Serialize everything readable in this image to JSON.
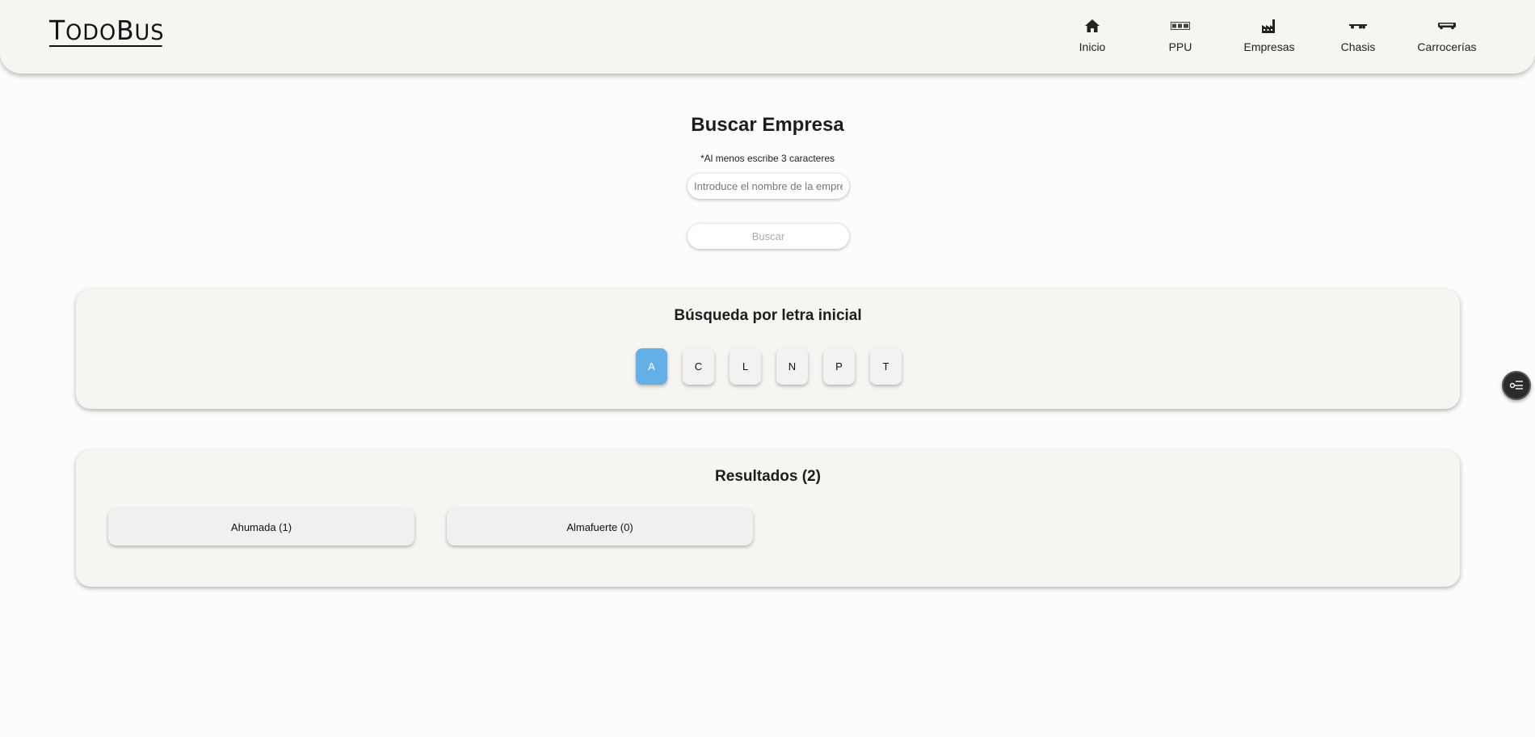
{
  "header": {
    "logo_text": "TODOBUS",
    "nav": [
      {
        "label": "Inicio",
        "icon": "home-icon"
      },
      {
        "label": "PPU",
        "icon": "license-plate-icon"
      },
      {
        "label": "Empresas",
        "icon": "factory-icon"
      },
      {
        "label": "Chasis",
        "icon": "chassis-icon"
      },
      {
        "label": "Carrocerías",
        "icon": "bus-icon"
      }
    ]
  },
  "search": {
    "title": "Buscar Empresa",
    "hint": "*Al menos escribe 3 caracteres",
    "placeholder": "Introduce el nombre de la empresa",
    "button_label": "Buscar"
  },
  "letters_section": {
    "title": "Búsqueda por letra inicial",
    "letters": [
      "A",
      "C",
      "L",
      "N",
      "P",
      "T"
    ],
    "active": "A"
  },
  "results_section": {
    "title": "Resultados (2)",
    "items": [
      "Ahumada (1)",
      "Almafuerte (0)"
    ]
  },
  "fab": {
    "icon": "filter-settings-icon"
  }
}
